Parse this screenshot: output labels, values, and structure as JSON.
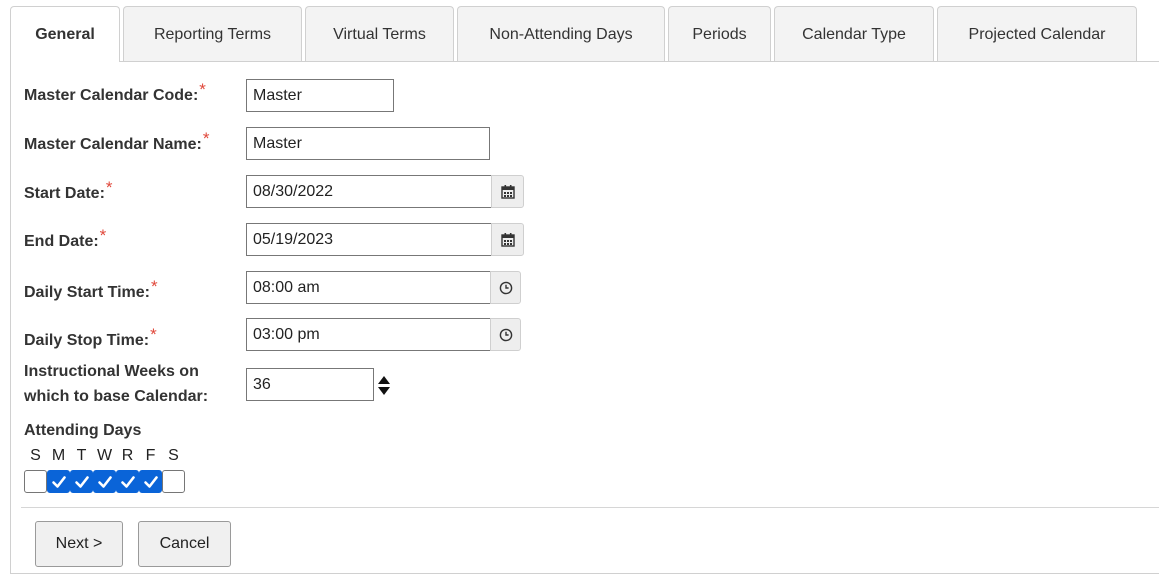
{
  "tabs": [
    {
      "label": "General",
      "active": true
    },
    {
      "label": "Reporting Terms",
      "active": false
    },
    {
      "label": "Virtual Terms",
      "active": false
    },
    {
      "label": "Non-Attending Days",
      "active": false
    },
    {
      "label": "Periods",
      "active": false
    },
    {
      "label": "Calendar Type",
      "active": false
    },
    {
      "label": "Projected Calendar",
      "active": false
    }
  ],
  "form": {
    "required_mark": "*",
    "code": {
      "label": "Master Calendar Code:",
      "value": "Master"
    },
    "name": {
      "label": "Master Calendar Name:",
      "value": "Master"
    },
    "start_date": {
      "label": "Start Date:",
      "value": "08/30/2022",
      "icon": "calendar-icon"
    },
    "end_date": {
      "label": "End Date:",
      "value": "05/19/2023",
      "icon": "calendar-icon"
    },
    "daily_start": {
      "label": "Daily Start Time:",
      "value": "08:00 am",
      "icon": "clock-icon"
    },
    "daily_stop": {
      "label": "Daily Stop Time:",
      "value": "03:00 pm",
      "icon": "clock-icon"
    },
    "weeks": {
      "label_line1": "Instructional Weeks on",
      "label_line2": "which to base Calendar:",
      "value": "36"
    },
    "attending": {
      "label": "Attending Days",
      "days": [
        {
          "letter": "S",
          "checked": false
        },
        {
          "letter": "M",
          "checked": true
        },
        {
          "letter": "T",
          "checked": true
        },
        {
          "letter": "W",
          "checked": true
        },
        {
          "letter": "R",
          "checked": true
        },
        {
          "letter": "F",
          "checked": true
        },
        {
          "letter": "S",
          "checked": false
        }
      ]
    }
  },
  "buttons": {
    "next": "Next >",
    "cancel": "Cancel"
  },
  "colors": {
    "required": "#e0473a",
    "checkbox_checked": "#0a64d8"
  }
}
